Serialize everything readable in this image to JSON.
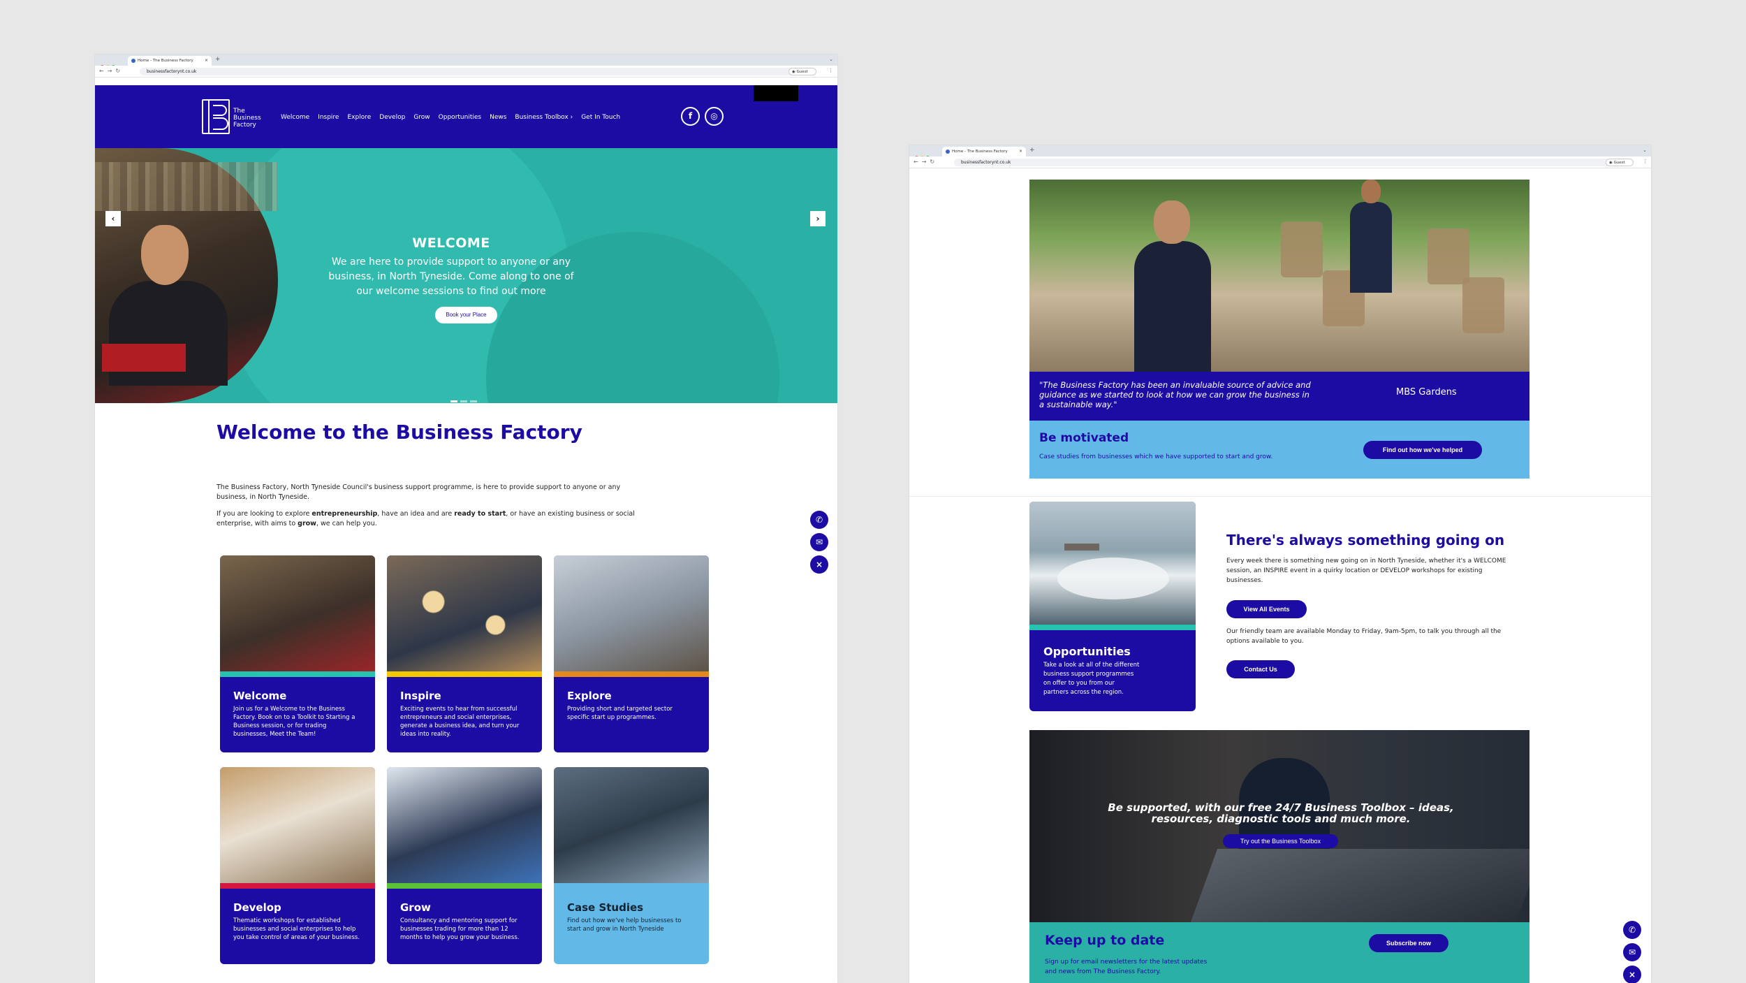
{
  "browser": {
    "tab_title": "Home - The Business Factory",
    "url": "businessfactorynt.co.uk",
    "guest_label": "Guest"
  },
  "colors": {
    "brand_navy": "#1d0ca3",
    "teal": "#2ab0a5",
    "light_blue": "#62b9e7"
  },
  "header": {
    "logo_lines": [
      "The",
      "Business",
      "Factory"
    ],
    "nav": [
      "Welcome",
      "Inspire",
      "Explore",
      "Develop",
      "Grow",
      "Opportunities",
      "News",
      "Business Toolbox ›",
      "Get In Touch"
    ],
    "social": [
      "facebook-icon",
      "instagram-icon"
    ]
  },
  "hero": {
    "title": "WELCOME",
    "text": "We are here to provide support to anyone or any business, in North Tyneside. Come along to one of our welcome sessions to find out more",
    "button": "Book your Place"
  },
  "welcome": {
    "heading": "Welcome to the Business Factory",
    "p1": "The Business Factory, North Tyneside Council's business support programme, is here to provide support to anyone or any business, in North Tyneside.",
    "p2_parts": [
      "If you are looking to explore ",
      "entrepreneurship",
      ", have an idea and are ",
      "ready to start",
      ", or have an existing business or social enterprise, with aims to ",
      "grow",
      ", we can help you."
    ]
  },
  "cards": [
    {
      "title": "Welcome",
      "desc": "Join us for a Welcome to the Business Factory. Book on to a Toolkit to Starting a Business session, or for trading businesses, Meet the Team!"
    },
    {
      "title": "Inspire",
      "desc": "Exciting events to hear from successful entrepreneurs and social enterprises, generate a business idea, and turn your ideas into reality."
    },
    {
      "title": "Explore",
      "desc": "Providing short and targeted sector specific start up programmes."
    },
    {
      "title": "Develop",
      "desc": "Thematic workshops for established businesses and social enterprises to help you take control of areas of your business."
    },
    {
      "title": "Grow",
      "desc": "Consultancy and mentoring support for businesses trading for more than 12 months to help you grow your business."
    },
    {
      "title": "Case Studies",
      "desc": "Find out how we've help businesses to start and grow in North Tyneside"
    }
  ],
  "page2": {
    "quote": "\"The Business Factory has been an invaluable source of advice and guidance as we started to look at how we can grow the business in a sustainable way.\"",
    "quote_name": "MBS Gardens",
    "motivated_title": "Be motivated",
    "motivated_text": "Case studies from businesses which we have supported to start and grow.",
    "motivated_button": "Find out how we've helped",
    "opp_title": "Opportunities",
    "opp_text": "Take a look at all of the different business support programmes on offer to you from our partners across the region.",
    "always_title": "There's always something going on",
    "always_text": "Every week there is something new going on in North Tyneside, whether it's a WELCOME session, an INSPIRE event in a quirky location or DEVELOP workshops for existing businesses.",
    "view_events": "View All Events",
    "team_text": "Our friendly team are available Monday to Friday, 9am-5pm, to talk you through all the options available to you.",
    "contact_button": "Contact Us",
    "toolbox_text": "Be supported, with our free 24/7 Business Toolbox – ideas, resources, diagnostic tools and much more.",
    "toolbox_button": "Try out the Business Toolbox",
    "keep_title": "Keep up to date",
    "keep_text": "Sign up for email newsletters for the latest updates and news from The Business Factory.",
    "subscribe_button": "Subscribe now"
  }
}
